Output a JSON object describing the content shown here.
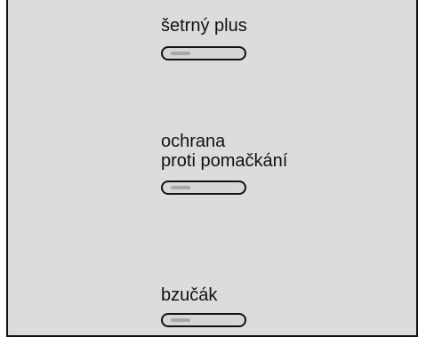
{
  "options": [
    {
      "label": "šetrný plus"
    },
    {
      "label": "ochrana\nproti pomačkání"
    },
    {
      "label": "bzučák"
    }
  ]
}
